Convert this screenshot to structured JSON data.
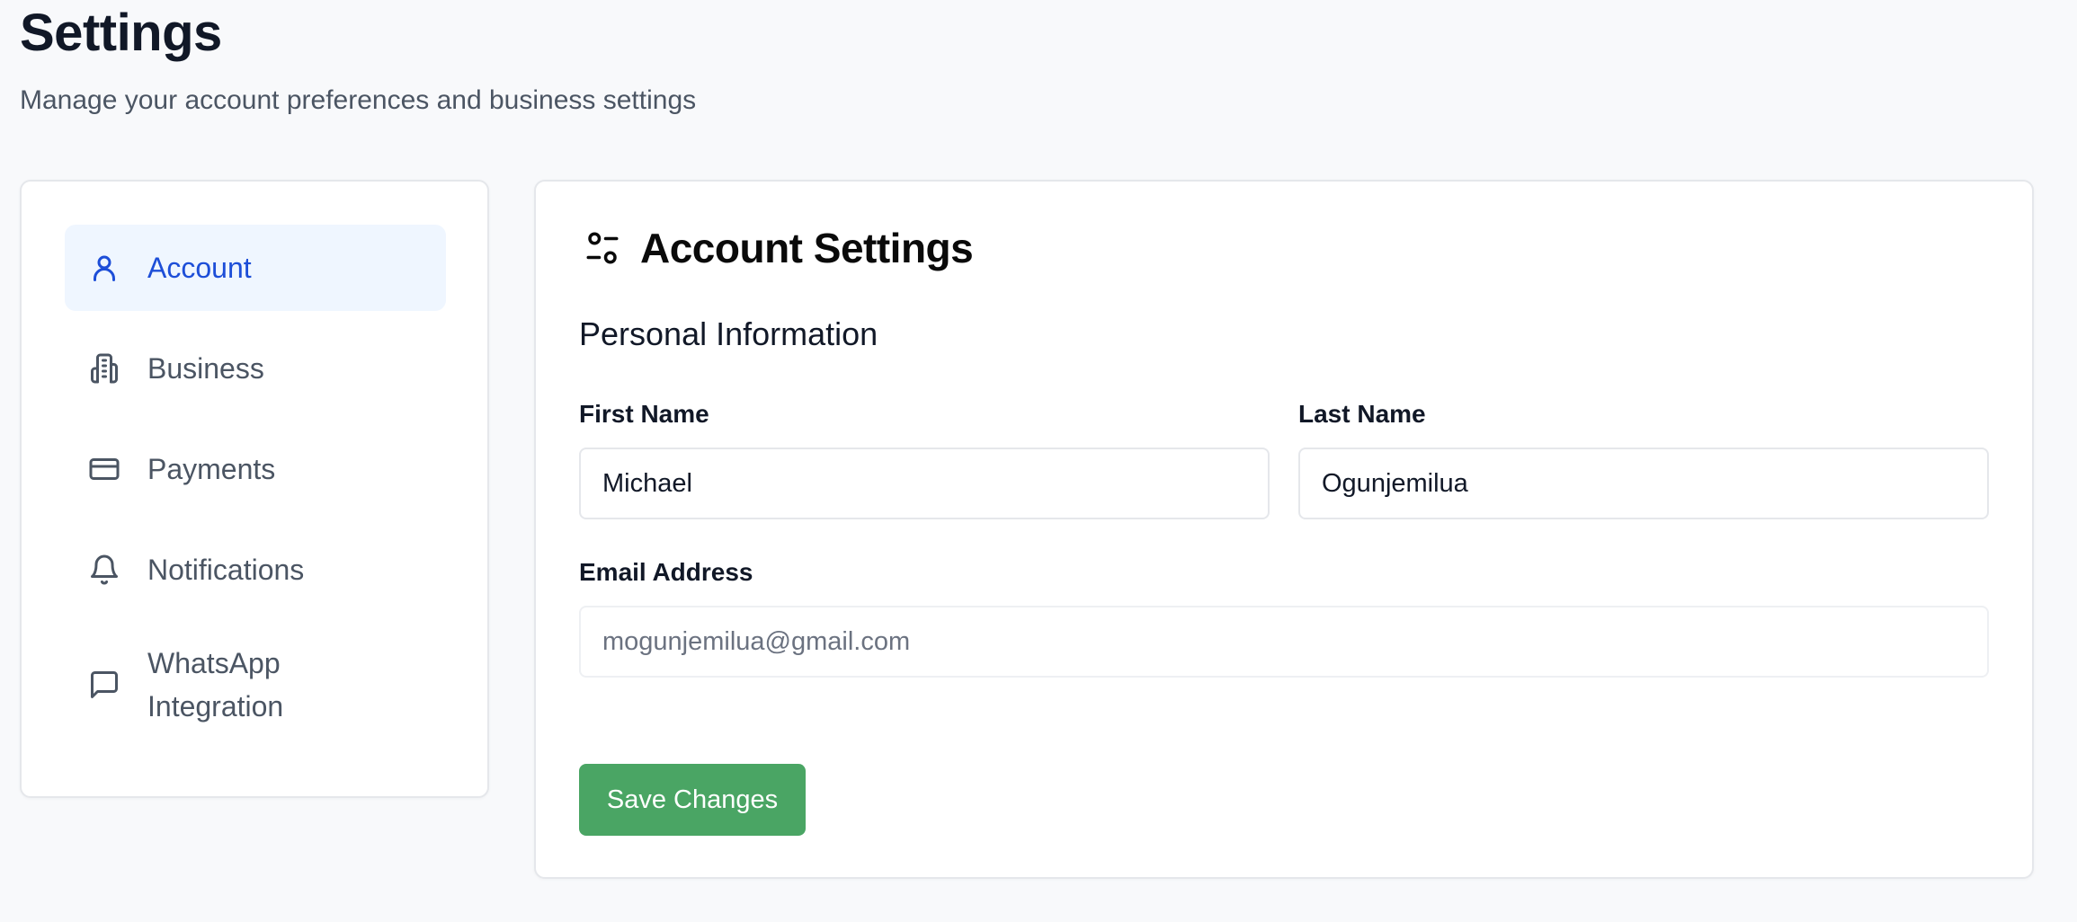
{
  "page": {
    "title": "Settings",
    "subtitle": "Manage your account preferences and business settings"
  },
  "sidebar": {
    "items": [
      {
        "label": "Account",
        "icon": "user-icon",
        "active": true
      },
      {
        "label": "Business",
        "icon": "building-icon",
        "active": false
      },
      {
        "label": "Payments",
        "icon": "credit-card-icon",
        "active": false
      },
      {
        "label": "Notifications",
        "icon": "bell-icon",
        "active": false
      },
      {
        "label": "WhatsApp Integration",
        "icon": "message-icon",
        "active": false
      }
    ]
  },
  "panel": {
    "title": "Account Settings",
    "icon": "settings-sliders-icon",
    "section_title": "Personal Information",
    "fields": {
      "first_name": {
        "label": "First Name",
        "value": "Michael"
      },
      "last_name": {
        "label": "Last Name",
        "value": "Ogunjemilua"
      },
      "email": {
        "label": "Email Address",
        "value": "mogunjemilua@gmail.com"
      }
    },
    "save_label": "Save Changes"
  },
  "colors": {
    "accent": "#1d4ed8",
    "active_bg": "#eff6ff",
    "primary_button": "#4aa564",
    "muted_text": "#4b5563",
    "border": "#e5e7eb"
  }
}
